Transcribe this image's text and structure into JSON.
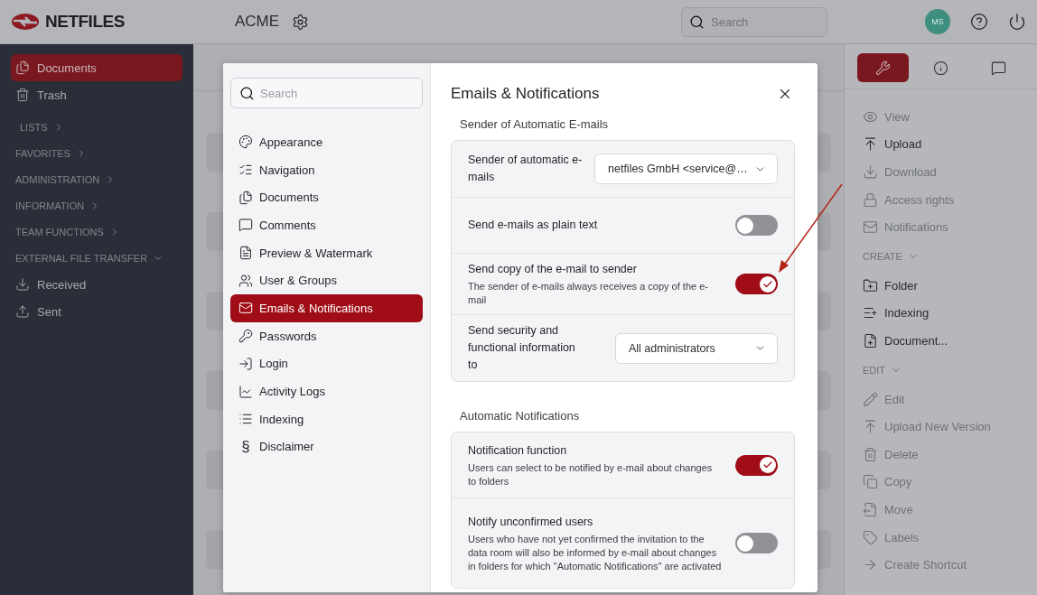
{
  "brand": {
    "name": "NETFILES"
  },
  "workspace": {
    "name": "ACME"
  },
  "top_search": {
    "placeholder": "Search"
  },
  "user": {
    "initials": "MS"
  },
  "sidebar": {
    "items": [
      {
        "label": "Documents",
        "kind": "documents",
        "selected": true
      },
      {
        "label": "Trash",
        "kind": "trash",
        "selected": false
      }
    ],
    "sections": [
      {
        "label": "LISTS",
        "expanded": false
      },
      {
        "label": "FAVORITES",
        "expanded": false
      },
      {
        "label": "ADMINISTRATION",
        "expanded": false
      },
      {
        "label": "INFORMATION",
        "expanded": false
      },
      {
        "label": "TEAM FUNCTIONS",
        "expanded": false
      },
      {
        "label": "EXTERNAL FILE TRANSFER",
        "expanded": true,
        "children": [
          {
            "label": "Received",
            "kind": "received",
            "selected": false
          },
          {
            "label": "Sent",
            "kind": "sent",
            "selected": false
          }
        ]
      }
    ]
  },
  "settings_dialog": {
    "search": {
      "placeholder": "Search"
    },
    "nav": [
      {
        "label": "Appearance",
        "kind": "palette",
        "selected": false
      },
      {
        "label": "Navigation",
        "kind": "checklist",
        "selected": false
      },
      {
        "label": "Documents",
        "kind": "documents",
        "selected": false
      },
      {
        "label": "Comments",
        "kind": "comment",
        "selected": false
      },
      {
        "label": "Preview & Watermark",
        "kind": "pdf",
        "selected": false
      },
      {
        "label": "User & Groups",
        "kind": "users",
        "selected": false
      },
      {
        "label": "Emails & Notifications",
        "kind": "mail",
        "selected": true
      },
      {
        "label": "Passwords",
        "kind": "key",
        "selected": false
      },
      {
        "label": "Login",
        "kind": "login",
        "selected": false
      },
      {
        "label": "Activity Logs",
        "kind": "chart",
        "selected": false
      },
      {
        "label": "Indexing",
        "kind": "list",
        "selected": false
      },
      {
        "label": "Disclaimer",
        "kind": "glyph",
        "glyph": "§",
        "selected": false
      }
    ],
    "title": "Emails & Notifications",
    "groups": [
      {
        "heading": "Sender of Automatic E-mails",
        "rows": [
          {
            "kind": "select",
            "label": "Sender of automatic e-mails",
            "value": "netfiles GmbH <service@…"
          },
          {
            "kind": "toggle",
            "label": "Send e-mails as plain text",
            "on": false
          },
          {
            "kind": "toggle",
            "label": "Send copy of the e-mail to sender",
            "description": "The sender of e-mails always receives a copy of the e-mail",
            "on": true
          },
          {
            "kind": "select",
            "label": "Send security and functional information to",
            "value": "All administrators"
          }
        ]
      },
      {
        "heading": "Automatic Notifications",
        "rows": [
          {
            "kind": "toggle",
            "label": "Notification function",
            "description": "Users can select to be notified by e-mail about changes to folders",
            "on": true
          },
          {
            "kind": "toggle",
            "label": "Notify unconfirmed users",
            "description": "Users who have not yet confirmed the invitation to the data room will also be informed by e-mail about changes in folders for which \"Automatic Notifications\" are activated",
            "on": false
          }
        ]
      }
    ]
  },
  "right_panel": {
    "tabs": [
      {
        "kind": "tools",
        "selected": true
      },
      {
        "kind": "info",
        "selected": false
      },
      {
        "kind": "comments",
        "selected": false
      }
    ],
    "groups": [
      {
        "items": [
          {
            "label": "View",
            "kind": "eye",
            "disabled": true
          },
          {
            "label": "Upload",
            "kind": "upload",
            "disabled": false
          },
          {
            "label": "Download",
            "kind": "download",
            "disabled": true
          },
          {
            "label": "Access rights",
            "kind": "lock",
            "disabled": true
          },
          {
            "label": "Notifications",
            "kind": "mail",
            "disabled": true
          }
        ]
      },
      {
        "heading": "CREATE",
        "expanded": true,
        "items": [
          {
            "label": "Folder",
            "kind": "folder-plus",
            "disabled": false
          },
          {
            "label": "Indexing",
            "kind": "list-plus",
            "disabled": false
          },
          {
            "label": "Document...",
            "kind": "file-plus",
            "disabled": false
          }
        ]
      },
      {
        "heading": "EDIT",
        "expanded": true,
        "items": [
          {
            "label": "Edit",
            "kind": "pencil",
            "disabled": true
          },
          {
            "label": "Upload New Version",
            "kind": "upload",
            "disabled": true
          },
          {
            "label": "Delete",
            "kind": "trash",
            "disabled": true
          },
          {
            "label": "Copy",
            "kind": "copy",
            "disabled": true
          },
          {
            "label": "Move",
            "kind": "move",
            "disabled": true
          },
          {
            "label": "Labels",
            "kind": "tag",
            "disabled": true
          },
          {
            "label": "Create Shortcut",
            "kind": "arrow",
            "disabled": true
          }
        ]
      }
    ]
  }
}
